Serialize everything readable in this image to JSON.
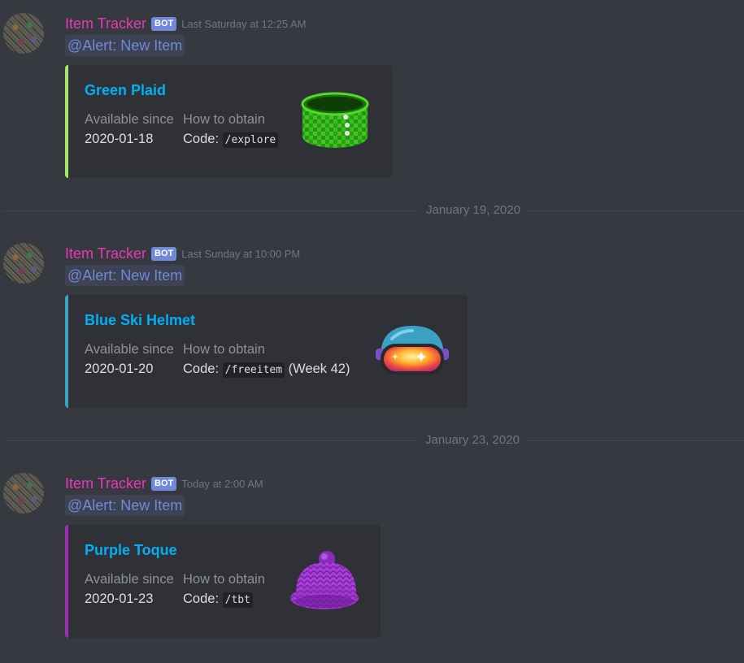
{
  "messages": [
    {
      "username": "Item Tracker",
      "bot_tag": "BOT",
      "timestamp": "Last Saturday at 12:25 AM",
      "mention": "@Alert: New Item",
      "embed": {
        "color": "#a3e86b",
        "title": "Green Plaid",
        "field1_name": "Available since",
        "field1_value": "2020-01-18",
        "field2_name": "How to obtain",
        "field2_prefix": "Code:",
        "field2_code": "/explore",
        "field2_suffix": "",
        "thumbnail_icon": "green-plaid-cuff-icon"
      }
    },
    {
      "username": "Item Tracker",
      "bot_tag": "BOT",
      "timestamp": "Last Sunday at 10:00 PM",
      "mention": "@Alert: New Item",
      "embed": {
        "color": "#3aa0c4",
        "title": "Blue Ski Helmet",
        "field1_name": "Available since",
        "field1_value": "2020-01-20",
        "field2_name": "How to obtain",
        "field2_prefix": "Code:",
        "field2_code": "/freeitem",
        "field2_suffix": "(Week 42)",
        "thumbnail_icon": "ski-helmet-icon"
      }
    },
    {
      "username": "Item Tracker",
      "bot_tag": "BOT",
      "timestamp": "Today at 2:00 AM",
      "mention": "@Alert: New Item",
      "embed": {
        "color": "#9b2fb5",
        "title": "Purple Toque",
        "field1_name": "Available since",
        "field1_value": "2020-01-23",
        "field2_name": "How to obtain",
        "field2_prefix": "Code:",
        "field2_code": "/tbt",
        "field2_suffix": "",
        "thumbnail_icon": "purple-toque-icon"
      }
    }
  ],
  "dividers": [
    {
      "label": "January 19, 2020"
    },
    {
      "label": "January 23, 2020"
    }
  ]
}
